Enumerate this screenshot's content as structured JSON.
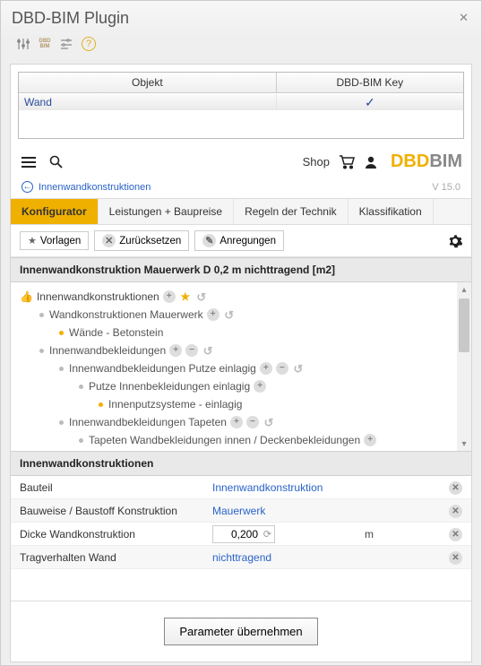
{
  "window": {
    "title": "DBD-BIM Plugin"
  },
  "mapping": {
    "headers": {
      "objekt": "Objekt",
      "key": "DBD-BIM Key"
    },
    "rows": [
      {
        "objekt": "Wand",
        "key": "✓"
      }
    ]
  },
  "topbar": {
    "shop": "Shop",
    "brand_dbd": "DBD",
    "brand_bim": "BIM"
  },
  "breadcrumb": {
    "label": "Innenwandkonstruktionen",
    "version": "V 15.0"
  },
  "tabs": {
    "konfigurator": "Konfigurator",
    "leistungen": "Leistungen + Baupreise",
    "regeln": "Regeln der Technik",
    "klassifikation": "Klassifikation",
    "active": "konfigurator"
  },
  "subtoolbar": {
    "vorlagen": "Vorlagen",
    "zuruecksetzen": "Zurücksetzen",
    "anregungen": "Anregungen"
  },
  "spec_title": "Innenwandkonstruktion Mauerwerk D 0,2 m nichttragend [m2]",
  "tree": {
    "n0": "Innenwandkonstruktionen",
    "n1": "Wandkonstruktionen Mauerwerk",
    "n2": "Wände - Betonstein",
    "n3": "Innenwandbekleidungen",
    "n4": "Innenwandbekleidungen Putze einlagig",
    "n5": "Putze Innenbekleidungen einlagig",
    "n6": "Innenputzsysteme - einlagig",
    "n7": "Innenwandbekleidungen Tapeten",
    "n8": "Tapeten Wandbekleidungen innen / Deckenbekleidungen"
  },
  "params_header": "Innenwandkonstruktionen",
  "params": {
    "r1": {
      "label": "Bauteil",
      "value": "Innenwandkonstruktion"
    },
    "r2": {
      "label": "Bauweise / Baustoff Konstruktion",
      "value": "Mauerwerk"
    },
    "r3": {
      "label": "Dicke Wandkonstruktion",
      "value": "0,200",
      "unit": "m"
    },
    "r4": {
      "label": "Tragverhalten Wand",
      "value": "nichttragend"
    }
  },
  "footer": {
    "apply": "Parameter übernehmen"
  }
}
